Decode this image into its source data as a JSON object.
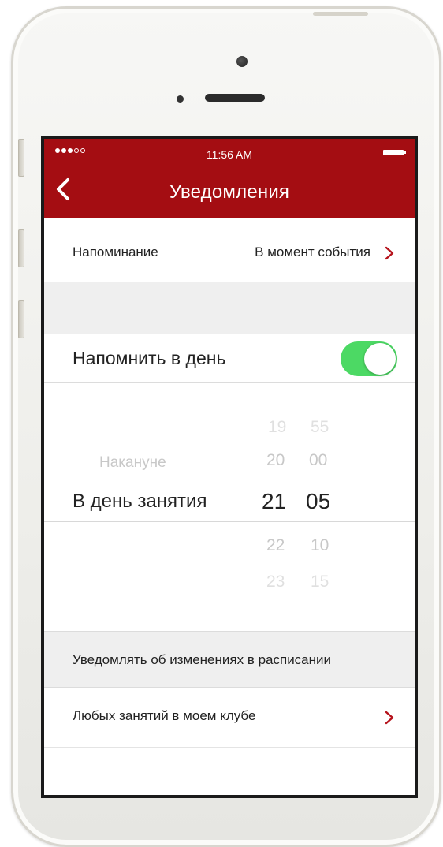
{
  "status_bar": {
    "time": "11:56 AM",
    "signal_dots_filled": 3,
    "signal_dots_total": 5
  },
  "nav": {
    "title": "Уведомления",
    "back_icon": "chevron-left-icon"
  },
  "reminder": {
    "label": "Напоминание",
    "value": "В момент события"
  },
  "remind_day": {
    "label": "Напомнить в день",
    "toggle_on": true
  },
  "picker": {
    "day_options": [
      "Накануне",
      "В день занятия"
    ],
    "selected_day": "В день занятия",
    "hours": [
      "19",
      "20",
      "21",
      "22",
      "23"
    ],
    "minutes": [
      "55",
      "00",
      "05",
      "10",
      "15"
    ],
    "selected_hour": "21",
    "selected_minute": "05"
  },
  "notify_section": {
    "header": "Уведомлять об изменениях в расписании",
    "item_label": "Любых занятий в моем клубе"
  },
  "colors": {
    "header_red": "#a40d12",
    "toggle_green": "#4cd964",
    "chevron_red": "#b5121b"
  }
}
